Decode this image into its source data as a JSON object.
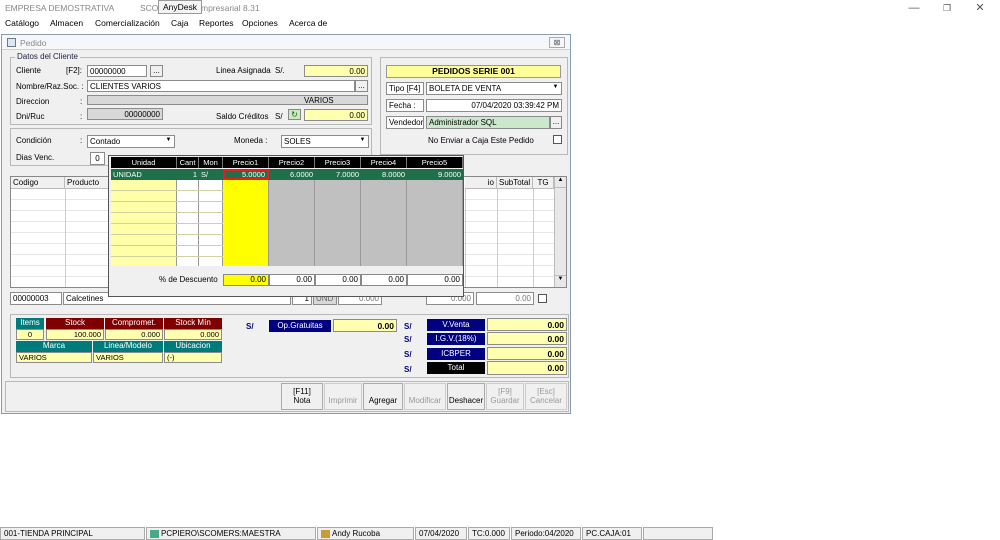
{
  "app": {
    "title": "EMPRESA DEMOSTRATIVA",
    "title_mid": "SCO",
    "anydesk": "AnyDesk",
    "title_tail": "mpresarial  8.31"
  },
  "menu": [
    "Catálogo",
    "Almacen",
    "Comercialización",
    "Caja",
    "Reportes",
    "Opciones",
    "Acerca de"
  ],
  "window": {
    "title": "Pedido",
    "close": "⊠"
  },
  "cliente": {
    "group_title": "Datos del Cliente",
    "cliente_label": "Cliente",
    "f2_label": "[F2]:",
    "cliente_code": "00000000",
    "nombre_label": "Nombre/Raz.Soc. :",
    "nombre_value": "CLIENTES VARIOS",
    "direccion_label": "Direccion",
    "colon": ":",
    "varios": "VARIOS",
    "dni_label": "Dni/Ruc",
    "dni_value": "00000000",
    "linea_label": "Linea Asignada",
    "linea_currency": "S/.",
    "linea_value": "0.00",
    "saldo_label": "Saldo Créditos",
    "saldo_currency": "S/",
    "saldo_value": "0.00",
    "dots": "..."
  },
  "pedido": {
    "header": "PEDIDOS SERIE 001",
    "tipo_label": "Tipo [F4]",
    "tipo_value": "BOLETA DE VENTA",
    "fecha_label": "Fecha :",
    "fecha_value": "07/04/2020 03:39:42 PM",
    "vendedor_label": "Vendedor",
    "vendedor_value": "Administrador SQL",
    "no_enviar_label": "No Enviar a Caja Este Pedido"
  },
  "condicion": {
    "condicion_label": "Condición",
    "condicion_value": "Contado",
    "dias_label": "Dias Venc.",
    "dias_value": "0",
    "moneda_label": "Moneda :",
    "moneda_value": "SOLES"
  },
  "main_grid": {
    "headers": [
      "Codigo",
      "Producto",
      "io",
      "SubTotal",
      "TG"
    ],
    "footer_row": {
      "codigo": "00000003",
      "producto": "Calcetines",
      "cant": "1",
      "und": "UND",
      "v1": "0.000",
      "v2": "0.000",
      "v3": "0.00"
    }
  },
  "popup": {
    "headers": [
      "Unidad",
      "Cant",
      "Mon",
      "Precio1",
      "Precio2",
      "Precio3",
      "Precio4",
      "Precio5"
    ],
    "row": {
      "unidad": "UNIDAD",
      "cant": "1",
      "mon": "S/",
      "p1": "5.0000",
      "p2": "6.0000",
      "p3": "7.0000",
      "p4": "8.0000",
      "p5": "9.0000"
    },
    "descuento_label": "% de Descuento",
    "descuentos": [
      "0.00",
      "0.00",
      "0.00",
      "0.00",
      "0.00"
    ]
  },
  "stock": {
    "items_label": "Items",
    "items_value": "0",
    "stock_label": "Stock",
    "stock_value": "100.000",
    "compromet_label": "Compromet.",
    "compromet_value": "0.000",
    "stockmin_label": "Stock Mín",
    "stockmin_value": "0.000",
    "marca_label": "Marca",
    "marca_value": "VARIOS",
    "linea_label": "Linea/Modelo",
    "linea_value": "VARIOS",
    "ubicacion_label": "Ubicacion",
    "ubicacion_value": "(-)"
  },
  "totals": {
    "currency": "S/",
    "op_gratuitas_label": "Op.Gratuitas",
    "op_gratuitas_value": "0.00",
    "vventa_label": "V.Venta",
    "vventa_value": "0.00",
    "igv_label": "I.G.V.(18%)",
    "igv_value": "0.00",
    "icbper_label": "ICBPER",
    "icbper_value": "0.00",
    "total_label": "Total",
    "total_value": "0.00"
  },
  "toolbar": {
    "nota_key": "[F11]",
    "nota": "Nota",
    "imprimir": "Imprimir",
    "agregar": "Agregar",
    "modificar": "Modificar",
    "deshacer": "Deshacer",
    "guardar_key": "[F9]",
    "guardar": "Guardar",
    "cancelar_key": "[Esc]",
    "cancelar": "Cancelar"
  },
  "status": {
    "tienda": "001-TIENDA PRINCIPAL",
    "db": "PCPIERO\\SCOMERS:MAESTRA",
    "user": "Andy Rucoba",
    "date": "07/04/2020",
    "tc": "TC:0.000",
    "periodo": "Periodo:04/2020",
    "caja": "PC.CAJA:01"
  },
  "colors": {
    "yellow": "#ffff00",
    "green_sel": "#1f6f4a",
    "navy": "#000080",
    "maroon": "#800000",
    "teal": "#007b7b"
  }
}
